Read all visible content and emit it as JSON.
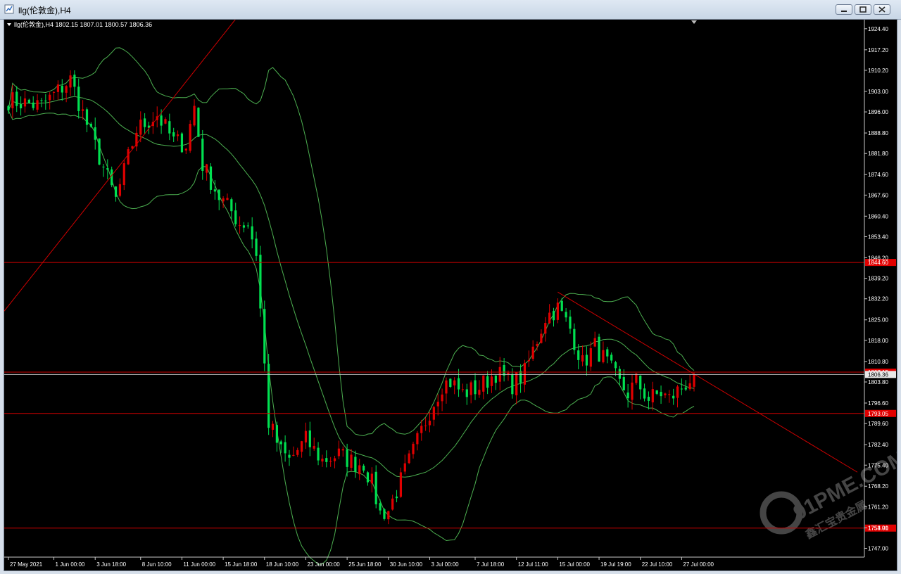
{
  "window": {
    "title": "llg(伦敦金),H4",
    "icon": "chart-window-icon"
  },
  "chart_data": {
    "type": "candlestick",
    "info_line": "llg(伦敦金),H4  1802.15 1807.01 1800.57 1806.36",
    "ohlc": {
      "open": 1802.15,
      "high": 1807.01,
      "low": 1800.57,
      "close": 1806.36
    },
    "ylim": [
      1744.0,
      1927.0
    ],
    "y_ticks": [
      "1924.40",
      "1917.20",
      "1910.20",
      "1903.00",
      "1896.00",
      "1888.80",
      "1881.80",
      "1874.60",
      "1867.60",
      "1860.40",
      "1853.40",
      "1846.20",
      "1839.20",
      "1832.20",
      "1825.00",
      "1818.00",
      "1810.80",
      "1803.80",
      "1796.60",
      "1789.60",
      "1782.40",
      "1775.40",
      "1768.20",
      "1761.20",
      "1754.00",
      "1747.00"
    ],
    "x_ticks": [
      "27 May 2021",
      "1 Jun 00:00",
      "3 Jun 18:00",
      "8 Jun 10:00",
      "11 Jun 00:00",
      "15 Jun 18:00",
      "18 Jun 10:00",
      "23 Jun 00:00",
      "25 Jun 18:00",
      "30 Jun 10:00",
      "3 Jul 00:00",
      "7 Jul 18:00",
      "12 Jul 11:00",
      "15 Jul 00:00",
      "19 Jul 19:00",
      "22 Jul 10:00",
      "27 Jul 00:00"
    ],
    "horizontal_levels": [
      {
        "value": 1844.6,
        "label": "1844.60"
      },
      {
        "value": 1807.15,
        "label": "1807.15"
      },
      {
        "value": 1793.05,
        "label": "1793.05"
      },
      {
        "value": 1753.91,
        "label": "1753.91"
      }
    ],
    "close_line": {
      "value": 1806.36,
      "label": "1806.36"
    },
    "trend_lines": [
      {
        "from": [
          "27 May 2021",
          1828.0
        ],
        "to": [
          "15 Jun 18:00",
          1939.0
        ]
      },
      {
        "from": [
          "15 Jul 00:00",
          1834.5
        ],
        "to": [
          "end",
          1773.0
        ]
      }
    ],
    "anchors": [
      [
        0,
        1900
      ],
      [
        8,
        1898
      ],
      [
        15,
        1907
      ],
      [
        20,
        1888
      ],
      [
        26,
        1866
      ],
      [
        31,
        1890
      ],
      [
        36,
        1895
      ],
      [
        40,
        1886
      ],
      [
        43,
        1885
      ],
      [
        45,
        1898
      ],
      [
        47,
        1878
      ],
      [
        51,
        1867
      ],
      [
        54,
        1862
      ],
      [
        56,
        1858
      ],
      [
        58,
        1858
      ],
      [
        60,
        1848
      ],
      [
        63,
        1790
      ],
      [
        66,
        1780
      ],
      [
        68,
        1777
      ],
      [
        72,
        1784
      ],
      [
        76,
        1777
      ],
      [
        80,
        1779
      ],
      [
        84,
        1776
      ],
      [
        86,
        1776
      ],
      [
        88,
        1769
      ],
      [
        90,
        1759
      ],
      [
        92,
        1760
      ],
      [
        95,
        1770
      ],
      [
        98,
        1780
      ],
      [
        102,
        1794
      ],
      [
        105,
        1803
      ],
      [
        107,
        1804
      ],
      [
        110,
        1800
      ],
      [
        114,
        1802
      ],
      [
        118,
        1807
      ],
      [
        122,
        1803
      ],
      [
        125,
        1807
      ],
      [
        130,
        1826
      ],
      [
        133,
        1829
      ],
      [
        136,
        1822
      ],
      [
        139,
        1810
      ],
      [
        142,
        1816
      ],
      [
        145,
        1810
      ],
      [
        148,
        1803
      ],
      [
        150,
        1800
      ],
      [
        152,
        1804
      ],
      [
        155,
        1798
      ],
      [
        158,
        1800
      ],
      [
        160,
        1798
      ],
      [
        163,
        1802
      ],
      [
        166,
        1806
      ]
    ],
    "watermark": {
      "brand": "91PME.COM",
      "slogan": "鑫汇宝贵金属"
    },
    "colors": {
      "background": "#000000",
      "up": "#e00000",
      "down": "#00e050",
      "grid_line": "#d00000",
      "band": "#4caf50",
      "text": "#ffffff"
    }
  }
}
